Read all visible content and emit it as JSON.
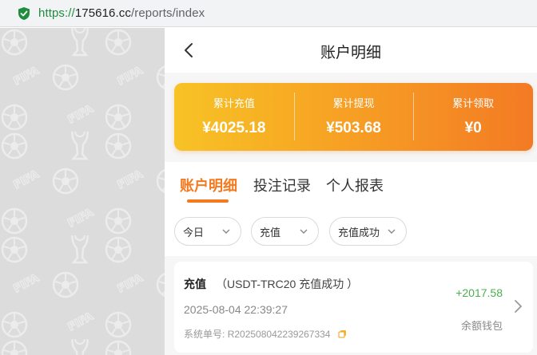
{
  "browser": {
    "url_protocol": "https://",
    "url_host": "175616.cc",
    "url_path": "/reports/index"
  },
  "header": {
    "title": "账户明细"
  },
  "summary": [
    {
      "label": "累计充值",
      "value": "¥4025.18"
    },
    {
      "label": "累计提现",
      "value": "¥503.68"
    },
    {
      "label": "累计领取",
      "value": "¥0"
    }
  ],
  "tabs": [
    {
      "label": "账户明细",
      "active": true
    },
    {
      "label": "投注记录",
      "active": false
    },
    {
      "label": "个人报表",
      "active": false
    }
  ],
  "filters": [
    {
      "value": "今日"
    },
    {
      "value": "充值"
    },
    {
      "value": "充值成功"
    }
  ],
  "record": {
    "type": "充值",
    "description": "（USDT-TRC20 充值成功 ）",
    "time": "2025-08-04 22:39:27",
    "order_label": "系统单号:",
    "order_no": "R202508042239267334",
    "amount": "+2017.58",
    "wallet": "余额钱包"
  },
  "colors": {
    "accent": "#f47a1f",
    "positive": "#4caf50",
    "gradient_start": "#f7c325",
    "gradient_end": "#f37a24"
  },
  "icons": [
    "secure-shield-icon",
    "back-arrow-icon",
    "chevron-down-icon",
    "copy-icon",
    "chevron-right-icon",
    "fifa-pattern"
  ]
}
